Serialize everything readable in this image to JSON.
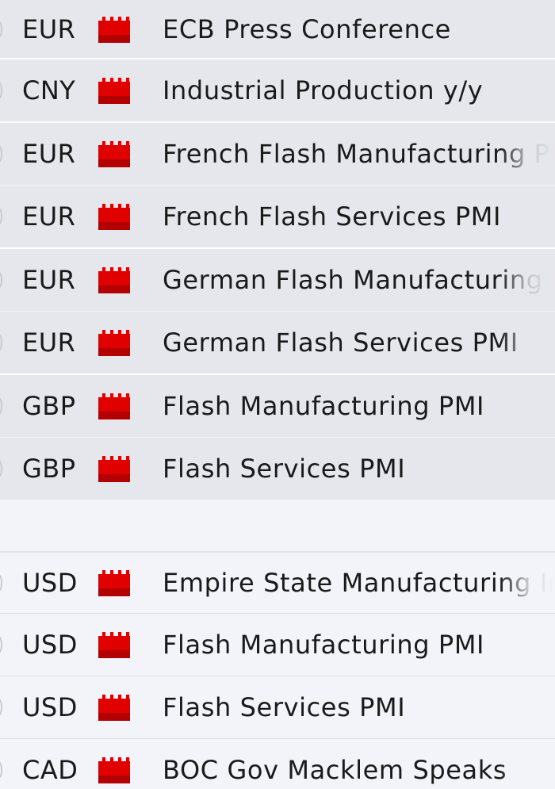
{
  "impact_icon": {
    "name": "high-impact-icon",
    "color": "#e00000"
  },
  "group_1": [
    {
      "currency": "EUR",
      "event": "ECB Press Conference"
    },
    {
      "currency": "CNY",
      "event": "Industrial Production y/y"
    },
    {
      "currency": "EUR",
      "event": "French Flash Manufacturing PMI"
    },
    {
      "currency": "EUR",
      "event": "French Flash Services PMI"
    },
    {
      "currency": "EUR",
      "event": "German Flash Manufacturing PMI"
    },
    {
      "currency": "EUR",
      "event": "German Flash Services PMI"
    },
    {
      "currency": "GBP",
      "event": "Flash Manufacturing PMI"
    },
    {
      "currency": "GBP",
      "event": "Flash Services PMI"
    }
  ],
  "group_2": [
    {
      "currency": "USD",
      "event": "Empire State Manufacturing Index"
    },
    {
      "currency": "USD",
      "event": "Flash Manufacturing PMI"
    },
    {
      "currency": "USD",
      "event": "Flash Services PMI"
    },
    {
      "currency": "CAD",
      "event": "BOC Gov Macklem Speaks"
    }
  ]
}
